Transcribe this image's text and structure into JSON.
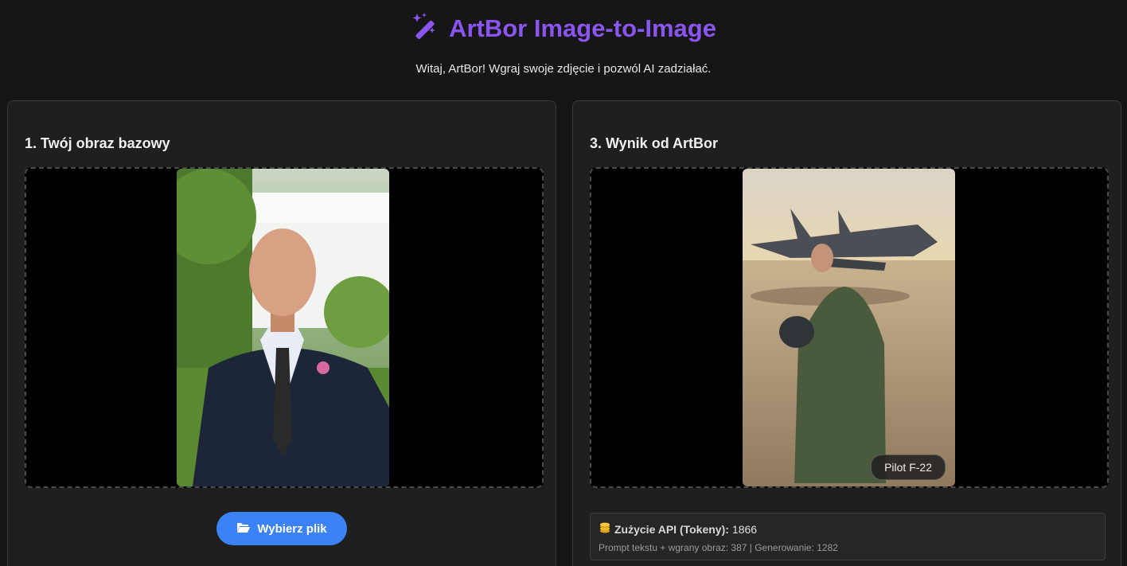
{
  "header": {
    "icon": "magic-wand-icon",
    "title": "ArtBor Image-to-Image",
    "subtitle": "Witaj, ArtBor! Wgraj swoje zdjęcie i pozwól AI zadziałać.",
    "accent": "#8a55f0"
  },
  "left_panel": {
    "heading": "1. Twój obraz bazowy",
    "upload_button_label": "Wybierz plik",
    "upload_icon": "folder-open-icon"
  },
  "right_panel": {
    "heading": "3. Wynik od ArtBor",
    "image_caption": "Pilot F-22",
    "usage": {
      "icon": "coins-icon",
      "label": "Zużycie API (Tokeny):",
      "total": "1866",
      "detail": "Prompt tekstu + wgrany obraz: 387 | Generowanie: 1282"
    }
  },
  "colors": {
    "background": "#161616",
    "panel": "#1f1f1f",
    "button": "#3b82f6"
  }
}
